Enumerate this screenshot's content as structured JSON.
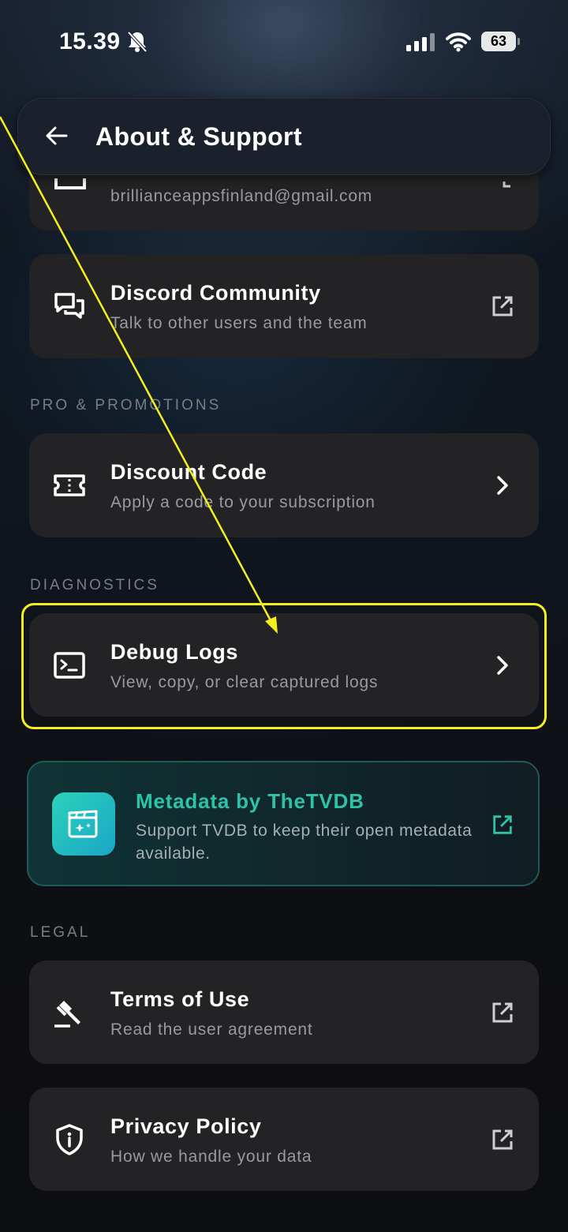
{
  "status": {
    "time": "15.39",
    "battery": "63"
  },
  "header": {
    "title": "About & Support"
  },
  "email_card": {
    "subtitle": "brillianceappsfinland@gmail.com"
  },
  "discord_card": {
    "title": "Discord Community",
    "subtitle": "Talk to other users and the team"
  },
  "sections": {
    "pro": "PRO & PROMOTIONS",
    "diagnostics": "DIAGNOSTICS",
    "legal": "LEGAL"
  },
  "discount_card": {
    "title": "Discount Code",
    "subtitle": "Apply a code to your subscription"
  },
  "debug_card": {
    "title": "Debug Logs",
    "subtitle": "View, copy, or clear captured logs"
  },
  "tvdb_card": {
    "title": "Metadata by TheTVDB",
    "text": "Support TVDB to keep their open metadata available."
  },
  "terms_card": {
    "title": "Terms of Use",
    "subtitle": "Read the user agreement"
  },
  "privacy_card": {
    "title": "Privacy Policy",
    "subtitle": "How we handle your data"
  },
  "colors": {
    "accent_teal": "#2ec3a8",
    "annotation_yellow": "#f4ef1e",
    "card_bg": "#232325"
  },
  "icons": [
    "bell-off-icon",
    "signal-icon",
    "wifi-icon",
    "battery-icon",
    "back-arrow-icon",
    "mail-icon",
    "chat-icon",
    "ticket-icon",
    "terminal-icon",
    "clapperboard-icon",
    "gavel-icon",
    "shield-info-icon",
    "external-link-icon",
    "chevron-right-icon"
  ]
}
